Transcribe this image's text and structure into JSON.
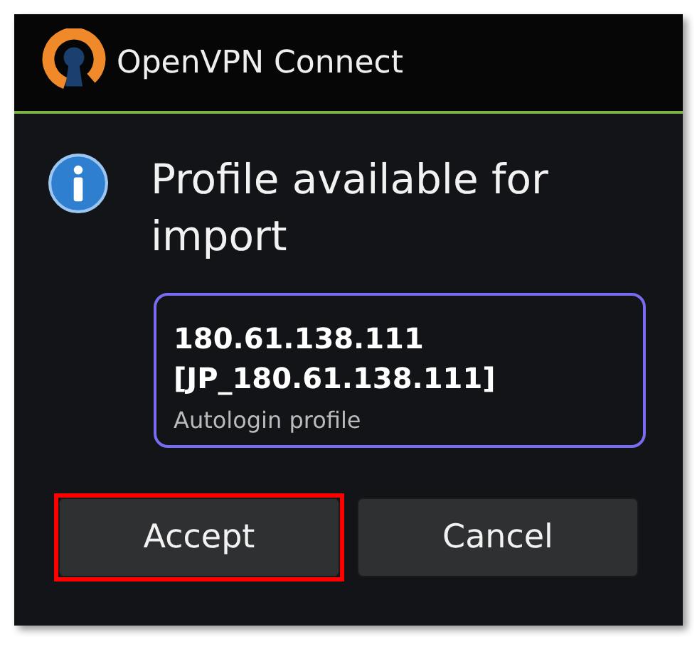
{
  "window": {
    "title": "OpenVPN Connect"
  },
  "message": "Profile available for import",
  "profile": {
    "name": "180.61.138.111 [JP_180.61.138.111]",
    "subtitle": "Autologin profile"
  },
  "buttons": [
    {
      "label": "Accept",
      "highlighted": true
    },
    {
      "label": "Cancel",
      "highlighted": false
    }
  ]
}
